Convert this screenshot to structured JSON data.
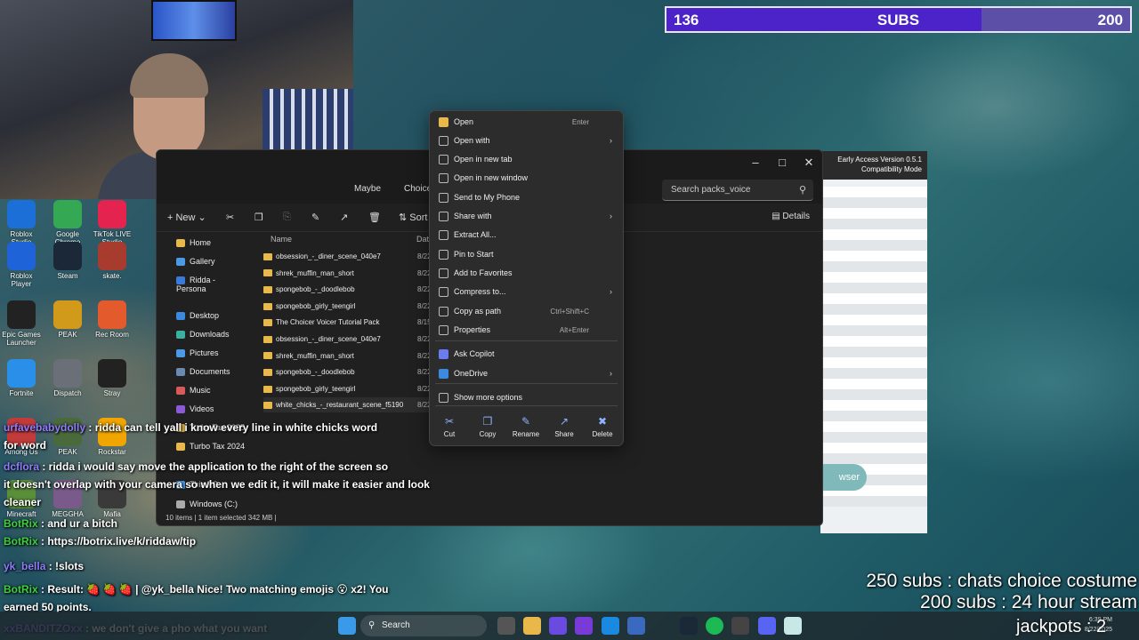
{
  "sub_goal": {
    "current": "136",
    "label": "SUBS",
    "goal": "200",
    "progress": 0.68
  },
  "desktop_icons": [
    {
      "label": "Roblox Studio",
      "color": "#1b6fd6"
    },
    {
      "label": "Google Chrome",
      "color": "#34a853"
    },
    {
      "label": "TikTok LIVE Studio",
      "color": "#e5234f"
    },
    {
      "label": "Roblox Player",
      "color": "#1e63d8"
    },
    {
      "label": "Steam",
      "color": "#1b2838"
    },
    {
      "label": "skate.",
      "color": "#a73b2d"
    },
    {
      "label": "Epic Games Launcher",
      "color": "#222222"
    },
    {
      "label": "PEAK",
      "color": "#d29a1a"
    },
    {
      "label": "Rec Room",
      "color": "#e35b2c"
    },
    {
      "label": "Fortnite",
      "color": "#2a8fe8"
    },
    {
      "label": "Dispatch",
      "color": "#6a6f78"
    },
    {
      "label": "Stray",
      "color": "#222222"
    },
    {
      "label": "Among Us",
      "color": "#c23b3b"
    },
    {
      "label": "PEAK",
      "color": "#4a6a3b"
    },
    {
      "label": "Rockstar",
      "color": "#f0a500"
    },
    {
      "label": "Minecraft",
      "color": "#5a8f3a"
    },
    {
      "label": "MEGGHA",
      "color": "#7a5a8a"
    },
    {
      "label": "Mafia",
      "color": "#3a3a3a"
    }
  ],
  "explorer": {
    "breadcrumb": [
      "Maybe",
      "Choice"
    ],
    "search_placeholder": "Search packs_voice",
    "toolbar": {
      "new": "New",
      "sort": "Sort",
      "details": "Details"
    },
    "nav": [
      {
        "label": "Home",
        "color": "#e8b94a"
      },
      {
        "label": "Gallery",
        "color": "#4a9ae8"
      },
      {
        "label": "Ridda - Persona",
        "color": "#3a7ad8"
      },
      {
        "label": "Desktop",
        "color": "#3a8ae0"
      },
      {
        "label": "Downloads",
        "color": "#3ab0a0"
      },
      {
        "label": "Pictures",
        "color": "#4a9ae8"
      },
      {
        "label": "Documents",
        "color": "#6a8ab0"
      },
      {
        "label": "Music",
        "color": "#d85a5a"
      },
      {
        "label": "Videos",
        "color": "#8a5ad8"
      },
      {
        "label": "Turbo Tax 2025",
        "color": "#e8b94a"
      },
      {
        "label": "Turbo Tax 2024",
        "color": "#e8b94a"
      },
      {
        "label": "This PC",
        "color": "#4a9ae8"
      },
      {
        "label": "Windows (C:)",
        "color": "#aaaaaa"
      }
    ],
    "columns": {
      "name": "Name",
      "date": "Date"
    },
    "files": [
      {
        "name": "obsession_-_diner_scene_040e7",
        "date": "8/22"
      },
      {
        "name": "shrek_muffin_man_short",
        "date": "8/22"
      },
      {
        "name": "spongebob_-_doodlebob",
        "date": "8/22"
      },
      {
        "name": "spongebob_girly_teengirl",
        "date": "8/22"
      },
      {
        "name": "The Choicer Voicer Tutorial Pack",
        "date": "8/15"
      },
      {
        "name": "obsession_-_diner_scene_040e7",
        "date": "8/22"
      },
      {
        "name": "shrek_muffin_man_short",
        "date": "8/22"
      },
      {
        "name": "spongebob_-_doodlebob",
        "date": "8/22"
      },
      {
        "name": "spongebob_girly_teengirl",
        "date": "8/22"
      },
      {
        "name": "white_chicks_-_restaurant_scene_f5190",
        "date": "8/22"
      }
    ],
    "status": "10 items   |   1 item selected  342 MB   |"
  },
  "appwin": {
    "version": "Early Access Version 0.5.1",
    "mode": "Compatibility Mode",
    "pill": "e\nwser"
  },
  "context_menu": {
    "items": [
      {
        "label": "Open",
        "shortcut": "Enter",
        "arrow": false,
        "icon_color": "#e8b94a"
      },
      {
        "label": "Open with",
        "shortcut": "",
        "arrow": true,
        "icon_color": ""
      },
      {
        "label": "Open in new tab",
        "shortcut": "",
        "arrow": false,
        "icon_color": ""
      },
      {
        "label": "Open in new window",
        "shortcut": "",
        "arrow": false,
        "icon_color": ""
      },
      {
        "label": "Send to My Phone",
        "shortcut": "",
        "arrow": false,
        "icon_color": ""
      },
      {
        "label": "Share with",
        "shortcut": "",
        "arrow": true,
        "icon_color": ""
      },
      {
        "label": "Extract All...",
        "shortcut": "",
        "arrow": false,
        "icon_color": ""
      },
      {
        "label": "Pin to Start",
        "shortcut": "",
        "arrow": false,
        "icon_color": ""
      },
      {
        "label": "Add to Favorites",
        "shortcut": "",
        "arrow": false,
        "icon_color": ""
      },
      {
        "label": "Compress to...",
        "shortcut": "",
        "arrow": true,
        "icon_color": ""
      },
      {
        "label": "Copy as path",
        "shortcut": "Ctrl+Shift+C",
        "arrow": false,
        "icon_color": ""
      },
      {
        "label": "Properties",
        "shortcut": "Alt+Enter",
        "arrow": false,
        "icon_color": ""
      },
      {
        "label": "Ask Copilot",
        "shortcut": "",
        "arrow": false,
        "icon_color": "#6a7cf0"
      },
      {
        "label": "OneDrive",
        "shortcut": "",
        "arrow": true,
        "icon_color": "#3a8ae0"
      },
      {
        "label": "Show more options",
        "shortcut": "",
        "arrow": false,
        "icon_color": ""
      }
    ],
    "quick": [
      "Cut",
      "Copy",
      "Rename",
      "Share",
      "Delete"
    ]
  },
  "chat": [
    {
      "user": "urfavebabydolly",
      "text": " : ridda can tell yall i know every line in white chicks word",
      "color": "#8f7cff"
    },
    {
      "user": "",
      "text": "for word",
      "color": "#ffffff"
    },
    {
      "user": "dcflora",
      "text": " : ridda i would say move the application to the right of the screen so",
      "color": "#8f7cff"
    },
    {
      "user": "",
      "text": "it doesn't overlap with your camera so when we edit it, it will make it easier and look",
      "color": "#ffffff"
    },
    {
      "user": "",
      "text": "cleaner",
      "color": "#ffffff"
    },
    {
      "user": "BotRix",
      "text": " : and ur a bitch",
      "color": "#3ad13a"
    },
    {
      "user": "BotRix",
      "text": " : https://botrix.live/k/riddaw/tip",
      "color": "#3ad13a"
    },
    {
      "user": "yk_bella",
      "text": " : !slots",
      "color": "#8f7cff"
    },
    {
      "user": "BotRix",
      "text": " : Result: 🍓 🍓 🍓 | @yk_bella Nice! Two matching emojis 😮 x2! You",
      "color": "#3ad13a"
    },
    {
      "user": "",
      "text": "earned 50 points.",
      "color": "#ffffff"
    },
    {
      "user": "xxBANDITZOxx",
      "text": " : we don't give a pho what you want",
      "color": "#8f7cff"
    }
  ],
  "milestones": [
    "250 subs : chats choice costume",
    "200 subs : 24 hour stream"
  ],
  "taskbar": {
    "search": "Search",
    "time": "6:39 PM",
    "date": "8/22/2025",
    "jackpot": "jackpots : 2"
  }
}
